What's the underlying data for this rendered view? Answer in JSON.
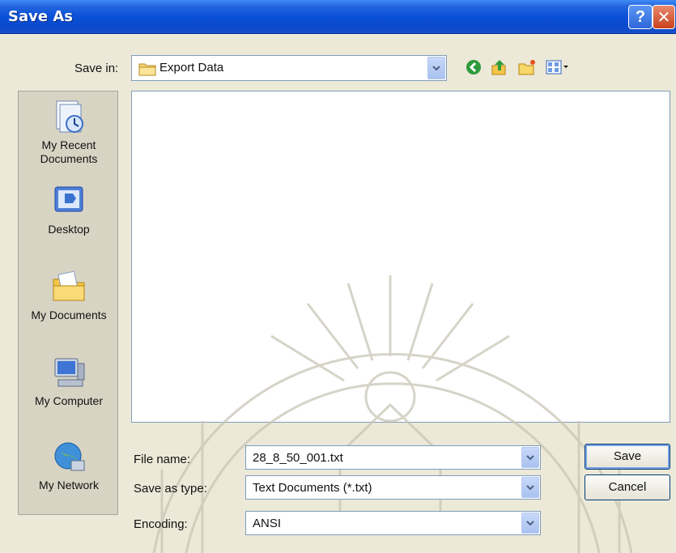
{
  "window": {
    "title": "Save As",
    "help_glyph": "?",
    "close_glyph": "✕"
  },
  "save_in": {
    "label": "Save in:",
    "value": "Export Data"
  },
  "toolbar": {
    "icons": [
      "back-icon",
      "up-folder-icon",
      "new-folder-icon",
      "views-menu-icon"
    ]
  },
  "places": [
    {
      "label": "My Recent\nDocuments",
      "icon": "recent-documents-icon"
    },
    {
      "label": "Desktop",
      "icon": "desktop-icon"
    },
    {
      "label": "My Documents",
      "icon": "my-documents-icon"
    },
    {
      "label": "My Computer",
      "icon": "my-computer-icon"
    },
    {
      "label": "My Network",
      "icon": "my-network-icon"
    }
  ],
  "file_name": {
    "label": "File name:",
    "value": "28_8_50_001.txt"
  },
  "save_as_type": {
    "label": "Save as type:",
    "value": "Text Documents (*.txt)"
  },
  "encoding": {
    "label": "Encoding:",
    "value": "ANSI"
  },
  "buttons": {
    "save": "Save",
    "cancel": "Cancel"
  },
  "colors": {
    "titlebar": "#0a50d8",
    "dialog_bg": "#ece9d8",
    "border": "#7f9db9"
  }
}
